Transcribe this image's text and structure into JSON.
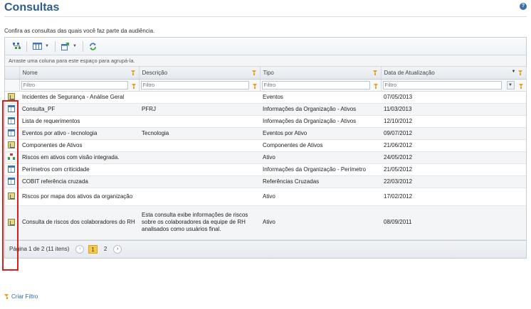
{
  "page": {
    "title": "Consultas",
    "subtitle": "Confira as consultas das quais você faz parte da audiência.",
    "help_icon": "?"
  },
  "toolbar": {
    "icons": [
      "group-tree-icon",
      "columns-icon",
      "export-icon",
      "refresh-icon"
    ]
  },
  "group_bar": {
    "text": "Arraste uma coluna para este espaço para agrupá-la."
  },
  "columns": {
    "nome": "Nome",
    "descricao": "Descrição",
    "tipo": "Tipo",
    "data": "Data de Atualização"
  },
  "filters": {
    "placeholder": "Filtro"
  },
  "rows": [
    {
      "icon": "chart",
      "nome": "Incidentes de Segurança - Análise Geral",
      "descricao": "",
      "tipo": "Eventos",
      "data": "07/05/2013"
    },
    {
      "icon": "table",
      "nome": "Consulta_PF",
      "descricao": "PFRJ",
      "tipo": "Informações da Organização - Ativos",
      "data": "11/03/2013"
    },
    {
      "icon": "table",
      "nome": "Lista de requerimentos",
      "descricao": "",
      "tipo": "Informações da Organização - Ativos",
      "data": "12/10/2012"
    },
    {
      "icon": "table",
      "nome": "Eventos por ativo - tecnologia",
      "descricao": "Tecnologia",
      "tipo": "Eventos por Ativo",
      "data": "09/07/2012"
    },
    {
      "icon": "chart",
      "nome": "Componentes de Ativos",
      "descricao": "",
      "tipo": "Componentes de Ativos",
      "data": "21/06/2012"
    },
    {
      "icon": "tree",
      "nome": "Riscos em ativos com visão integrada.",
      "descricao": "",
      "tipo": "Ativo",
      "data": "24/05/2012"
    },
    {
      "icon": "table",
      "nome": "Perímetros com criticidade",
      "descricao": "",
      "tipo": "Informações da Organização - Perímetro",
      "data": "21/05/2012"
    },
    {
      "icon": "table",
      "nome": "COBIT referência cruzada",
      "descricao": "",
      "tipo": "Referências Cruzadas",
      "data": "22/03/2012"
    },
    {
      "icon": "chart",
      "nome": "Riscos por mapa dos ativos da organização",
      "descricao": "",
      "tipo": "Ativo",
      "data": "17/02/2012"
    },
    {
      "icon": "chart",
      "nome": "Consulta de riscos dos colaboradores do RH",
      "descricao": "Esta consulta exibe informações de riscos sobre os colaboradores da equipe de RH analisados como usuários final.",
      "tipo": "Ativo",
      "data": "08/09/2011"
    }
  ],
  "pager": {
    "summary": "Página 1 de 2 (11 itens)",
    "prev": "‹",
    "pages": [
      "1",
      "2"
    ],
    "next": "›"
  },
  "footer": {
    "create_filter": "Criar Filtro"
  }
}
